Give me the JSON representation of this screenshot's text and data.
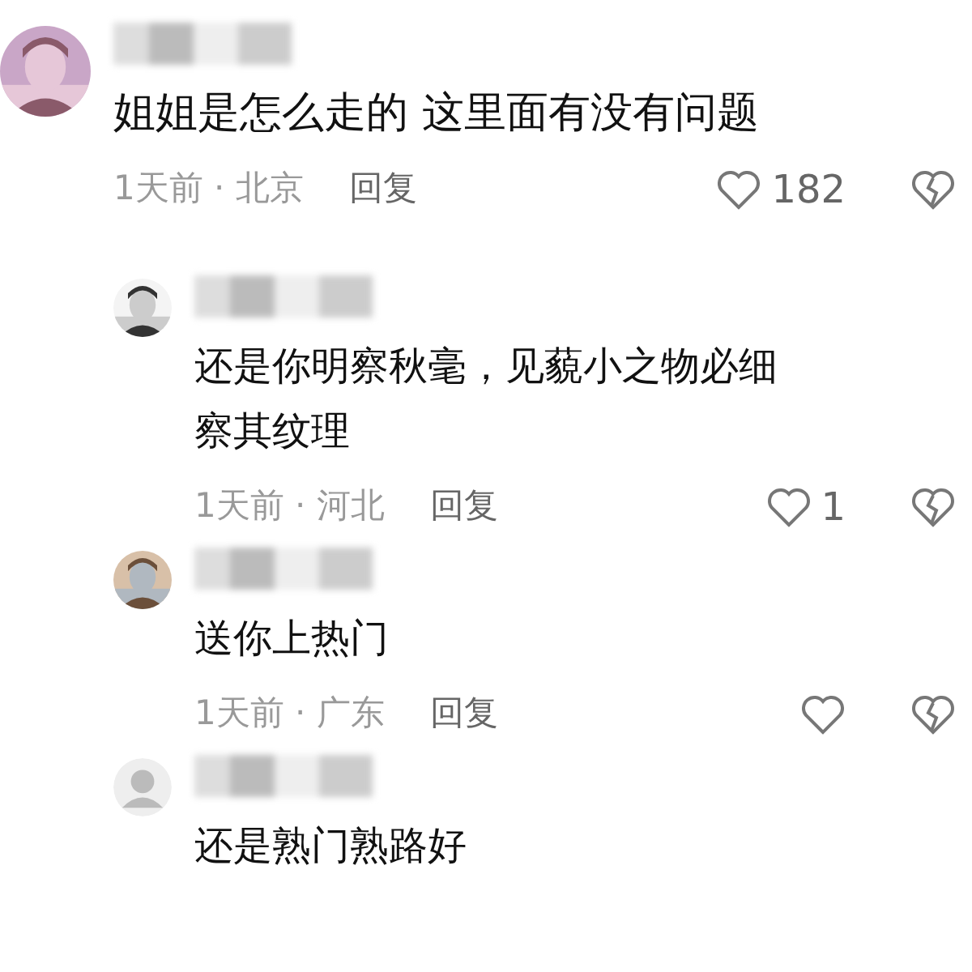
{
  "comments": [
    {
      "kind": "top",
      "body": "姐姐是怎么走的 这里面有没有问题",
      "meta": "1天前 · 北京",
      "reply_label": "回复",
      "likes": "182"
    },
    {
      "kind": "reply",
      "body": "还是你明察秋毫，见藐小之物必细察其纹理",
      "meta": "1天前 · 河北",
      "reply_label": "回复",
      "likes": "1"
    },
    {
      "kind": "reply",
      "body": "送你上热门",
      "meta": "1天前 · 广东",
      "reply_label": "回复"
    },
    {
      "kind": "reply",
      "avatar": {
        "kind": "default"
      },
      "body": "还是熟门熟路好"
    }
  ]
}
